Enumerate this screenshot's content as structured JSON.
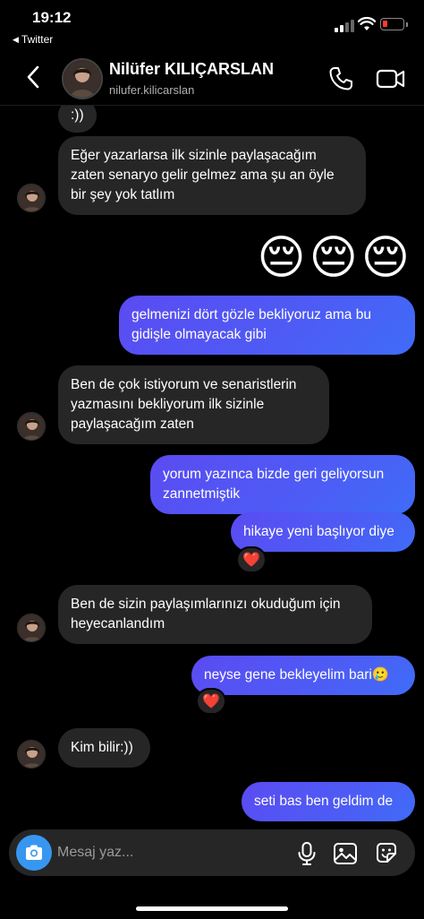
{
  "status_bar": {
    "time": "19:12",
    "back_app": "Twitter",
    "battery_color": "#ff3b30"
  },
  "header": {
    "name": "Nilüfer KILIÇARSLAN",
    "username": "nilufer.kilicarslan",
    "back_icon": "chevron-left-icon",
    "call_icon": "phone-icon",
    "video_icon": "video-camera-icon"
  },
  "messages": [
    {
      "sender": "them",
      "text": ":))"
    },
    {
      "sender": "them",
      "text": "Eğer yazarlarsa ilk sizinle paylaşacağım zaten senaryo gelir gelmez ama şu an öyle bir şey yok tatlım"
    },
    {
      "sender": "me",
      "text": "😔😔😔"
    },
    {
      "sender": "me",
      "text": "gelmenizi dört gözle bekliyoruz ama bu gidişle olmayacak gibi"
    },
    {
      "sender": "them",
      "text": "Ben de çok istiyorum ve senaristlerin yazmasını bekliyorum ilk sizinle paylaşacağım zaten"
    },
    {
      "sender": "me",
      "text": "yorum yazınca bizde geri geliyorsun zannetmiştik"
    },
    {
      "sender": "me",
      "text": "hikaye yeni başlıyor diye",
      "reaction": "❤️"
    },
    {
      "sender": "them",
      "text": "Ben de sizin paylaşımlarınızı okuduğum için heyecanlandım"
    },
    {
      "sender": "me",
      "text": "neyse gene bekleyelim bari🥲",
      "reaction": "❤️"
    },
    {
      "sender": "them",
      "text": "Kim bilir:))"
    },
    {
      "sender": "me",
      "text": "seti bas ben geldim de"
    }
  ],
  "composer": {
    "placeholder": "Mesaj yaz...",
    "camera_icon": "camera-icon",
    "mic_icon": "microphone-icon",
    "gallery_icon": "image-icon",
    "sticker_icon": "sticker-icon",
    "accent": "#3797f0"
  },
  "colors": {
    "sent_bubble": "#4d5cf5",
    "received_bubble": "#262626",
    "background": "#000000"
  }
}
